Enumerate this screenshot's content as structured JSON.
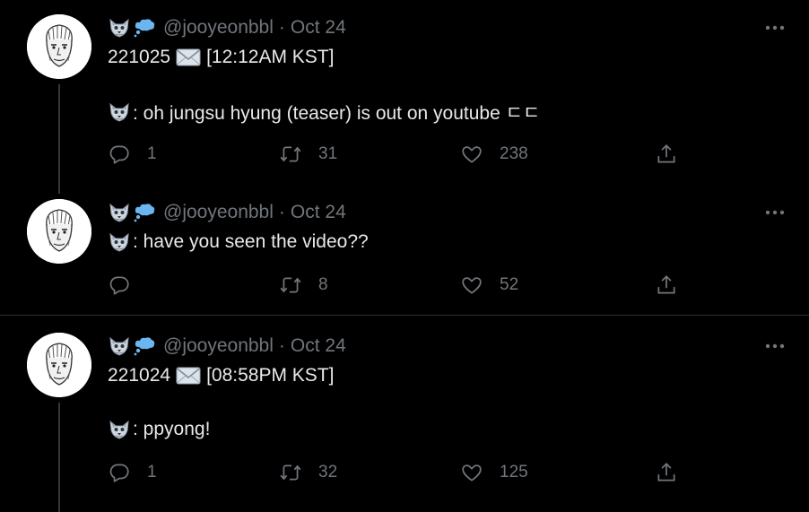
{
  "colors": {
    "background": "#000000",
    "text": "#e7e9ea",
    "muted": "#71767b",
    "divider": "#2f3336"
  },
  "icons": {
    "avatar": "sketch-portrait-avatar",
    "name_emoji_1": "wolf-face-emoji",
    "name_emoji_2": "thought-balloon-emoji",
    "envelope": "envelope-emoji",
    "more": "more-horizontal-icon",
    "reply": "reply-icon",
    "retweet": "retweet-icon",
    "like": "heart-icon",
    "share": "share-icon"
  },
  "tweets": [
    {
      "handle": "@jooyeonbbl",
      "separator": "·",
      "date": "Oct 24",
      "line1_date": "221025",
      "line1_time": "[12:12AM KST]",
      "line2": ": oh jungsu hyung (teaser) is out on youtube ㄷㄷ",
      "reply_count": "1",
      "retweet_count": "31",
      "like_count": "238"
    },
    {
      "handle": "@jooyeonbbl",
      "separator": "·",
      "date": "Oct 24",
      "line1": ": have you seen the video??",
      "reply_count": "",
      "retweet_count": "8",
      "like_count": "52"
    },
    {
      "handle": "@jooyeonbbl",
      "separator": "·",
      "date": "Oct 24",
      "line1_date": "221024",
      "line1_time": "[08:58PM KST]",
      "line2": ": ppyong!",
      "reply_count": "1",
      "retweet_count": "32",
      "like_count": "125"
    }
  ]
}
